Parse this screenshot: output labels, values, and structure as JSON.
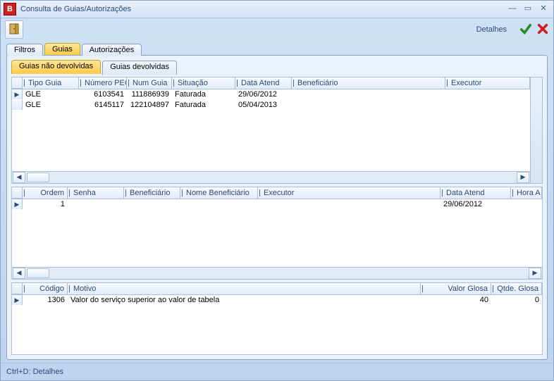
{
  "window": {
    "title": "Consulta de Guias/Autorizações",
    "app_icon_letter": "B"
  },
  "toolbar": {
    "details_label": "Detalhes"
  },
  "tabs": {
    "main": [
      {
        "label": "Filtros",
        "active": false
      },
      {
        "label": "Guias",
        "active": true
      },
      {
        "label": "Autorizações",
        "active": false
      }
    ],
    "sub": [
      {
        "label": "Guias não devolvidas",
        "active": true
      },
      {
        "label": "Guias devolvidas",
        "active": false
      }
    ]
  },
  "grid1": {
    "headers": [
      "Tipo Guia",
      "Número PEG",
      "Num Guia",
      "Situação",
      "Data Atend",
      "Beneficiário",
      "Executor"
    ],
    "rows": [
      {
        "tipo": "GLE",
        "peg": "6103541",
        "num": "111886939",
        "sit": "Faturada",
        "data": "29/06/2012",
        "benef": "",
        "exec": ""
      },
      {
        "tipo": "GLE",
        "peg": "6145117",
        "num": "122104897",
        "sit": "Faturada",
        "data": "05/04/2013",
        "benef": "",
        "exec": ""
      }
    ]
  },
  "grid2": {
    "headers": [
      "Ordem",
      "Senha",
      "Beneficiário",
      "Nome Beneficiário",
      "Executor",
      "Data Atend",
      "Hora A"
    ],
    "rows": [
      {
        "ordem": "1",
        "senha": "",
        "benef": "",
        "nome": "",
        "exec": "",
        "data": "29/06/2012",
        "hora": ""
      }
    ]
  },
  "grid3": {
    "headers": [
      "Código",
      "Motivo",
      "Valor Glosa",
      "Qtde. Glosa"
    ],
    "rows": [
      {
        "codigo": "1306",
        "motivo": "Valor do serviço superior ao valor de tabela",
        "valor": "40",
        "qtde": "0"
      }
    ]
  },
  "statusbar": {
    "hint": "Ctrl+D: Detalhes"
  }
}
